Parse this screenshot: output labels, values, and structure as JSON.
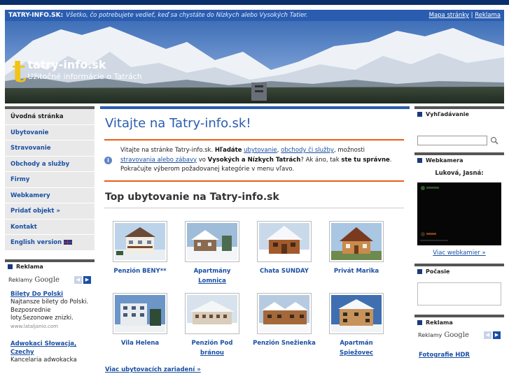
{
  "header": {
    "site_name": "TATRY-INFO.SK:",
    "tagline": "Všetko, čo potrebujete vedieť, keď sa chystáte do Nízkych alebo Vysokých Tatier.",
    "link_sitemap": "Mapa stránky",
    "separator": "|",
    "link_ads": "Reklama"
  },
  "banner": {
    "logo_mark": "t",
    "logo_title": "tatry-info.sk",
    "logo_subtitle": "Užitočné informácie o Tatrách"
  },
  "sidebar": {
    "items": [
      {
        "label": "Úvodná stránka"
      },
      {
        "label": "Ubytovanie"
      },
      {
        "label": "Stravovanie"
      },
      {
        "label": "Obchody a služby"
      },
      {
        "label": "Firmy"
      },
      {
        "label": "Webkamery"
      },
      {
        "label": "Pridať objekt »"
      },
      {
        "label": "Kontakt"
      },
      {
        "label": "English version"
      }
    ],
    "ads_heading": "Reklama",
    "ads_prefix": "Reklamy",
    "ads_brand": "Google",
    "ads": [
      {
        "title": "Bilety Do Polski",
        "text": "Najtansze bilety do Polski. Bezposrednie loty.Sezonowe znizki.",
        "url": "www.lataljanio.com"
      },
      {
        "title": "Adwokaci Słowacja, Czechy",
        "text": "Kancelaria adwokacka",
        "url": ""
      }
    ]
  },
  "main": {
    "title": "Vitajte na Tatry-info.sk!",
    "intro": {
      "t1": "Vitajte na stránke Tatry-info.sk. ",
      "b1": "Hľadáte",
      "l1": "ubytovanie",
      "t2": ", ",
      "l2": "obchody či služby",
      "t3": ", možnosti ",
      "l3": "stravovania alebo zábavy",
      "t4": " vo ",
      "b2": "Vysokých a Nízkych Tatrách",
      "t5": "? Ak áno, tak ",
      "b3": "ste tu správne",
      "t6": ". Pokračujte výberom požadovanej kategórie v menu vľavo."
    },
    "top_title": "Top ubytovanie na Tatry-info.sk",
    "accommodations": [
      {
        "line1": "Penzión BENY**",
        "line2": "",
        "link": false
      },
      {
        "line1": "Apartmány",
        "line2": "Lomnica",
        "link": true
      },
      {
        "line1": "Chata SUNDAY",
        "line2": "",
        "link": false
      },
      {
        "line1": "Privát Marika",
        "line2": "",
        "link": false
      },
      {
        "line1": "Vila Helena",
        "line2": "",
        "link": false
      },
      {
        "line1": "Penzión Pod",
        "line2": "bránou",
        "link": true
      },
      {
        "line1": "Penzión Snežienka",
        "line2": "",
        "link": false
      },
      {
        "line1": "Apartmán",
        "line2": "Spiežovec",
        "link": true
      }
    ],
    "more_link": "Viac ubytovacích zariadení »"
  },
  "right": {
    "search_heading": "Vyhľadávanie",
    "search_value": "",
    "webcam_heading": "Webkamera",
    "webcam_caption": "Luková, Jasná:",
    "webcam_more": "Viac webkamier »",
    "weather_heading": "Počasie",
    "ads_heading": "Reklama",
    "ads_prefix": "Reklamy",
    "ads_brand": "Google",
    "ad_title": "Fotografie HDR"
  },
  "colors": {
    "header_blue": "#2a5db0",
    "dark_navy": "#0b2f6b",
    "intro_orange": "#e85d14",
    "link_blue": "#1a4fa3"
  }
}
